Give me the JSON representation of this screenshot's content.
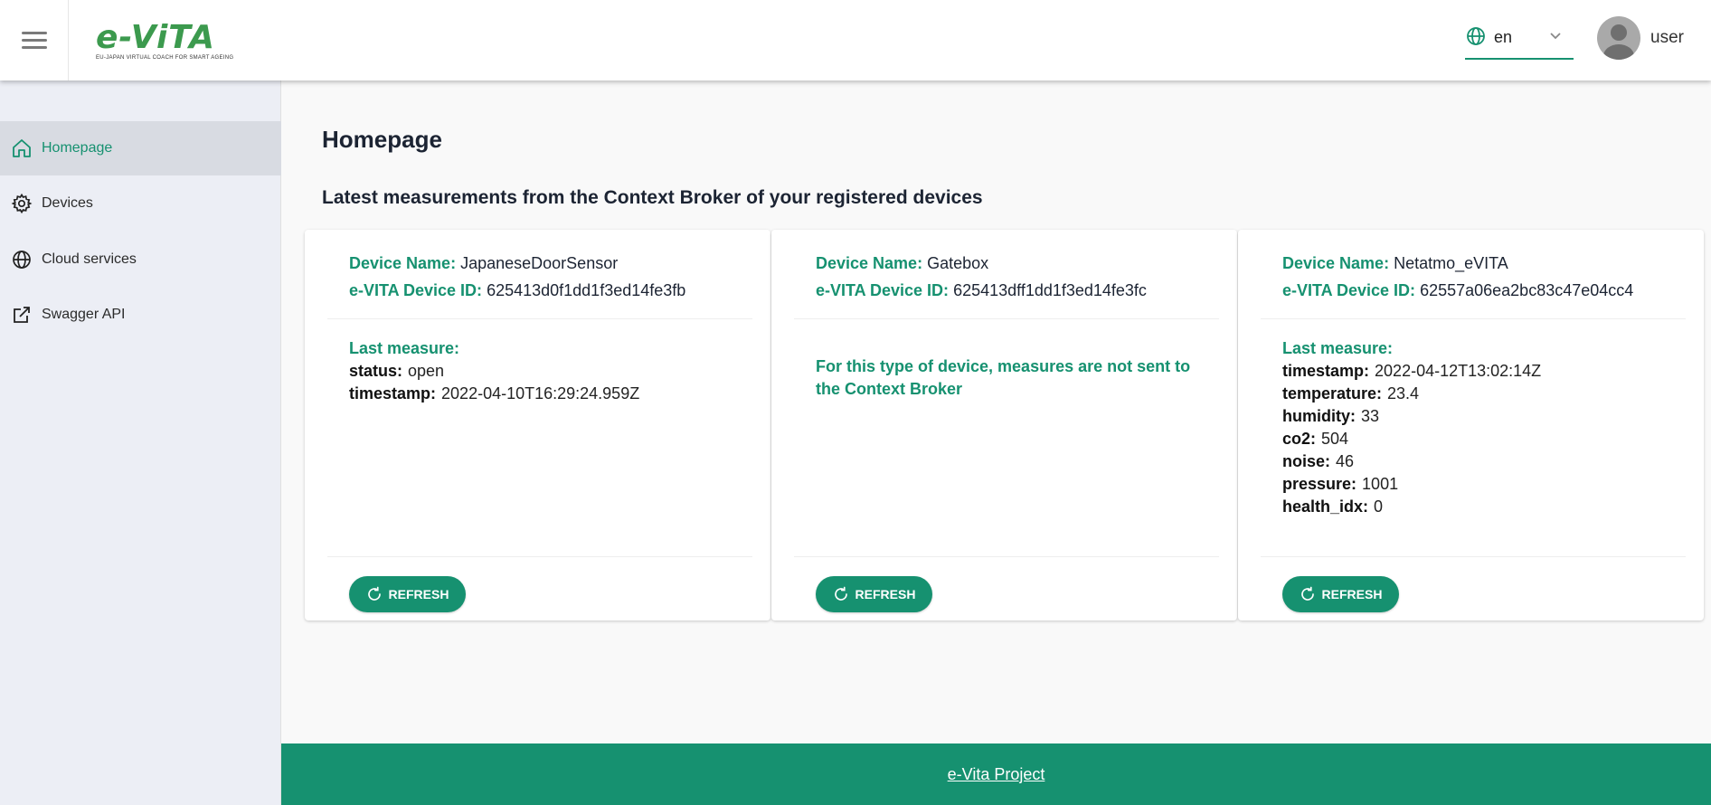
{
  "header": {
    "logo_text": "e-ViTA",
    "logo_subtitle": "EU-JAPAN VIRTUAL COACH FOR SMART AGEING",
    "language": "en",
    "username": "user"
  },
  "sidebar": {
    "items": [
      {
        "label": "Homepage",
        "icon": "home-icon",
        "active": true
      },
      {
        "label": "Devices",
        "icon": "gear-icon",
        "active": false
      },
      {
        "label": "Cloud services",
        "icon": "globe-icon",
        "active": false
      },
      {
        "label": "Swagger API",
        "icon": "external-link-icon",
        "active": false
      }
    ]
  },
  "main": {
    "title": "Homepage",
    "subtitle": "Latest measurements from the Context Broker of your registered devices",
    "labels": {
      "device_name": "Device Name:",
      "device_id": "e-VITA Device ID:",
      "last_measure": "Last measure:",
      "refresh": "REFRESH"
    },
    "cards": [
      {
        "device_name": "JapaneseDoorSensor",
        "device_id": "625413d0f1dd1f3ed14fe3fb",
        "measures": [
          {
            "key": "status:",
            "value": "open"
          },
          {
            "key": "timestamp:",
            "value": "2022-04-10T16:29:24.959Z"
          }
        ]
      },
      {
        "device_name": "Gatebox",
        "device_id": "625413dff1dd1f3ed14fe3fc",
        "note": "For this type of device, measures are not sent to the Context Broker"
      },
      {
        "device_name": "Netatmo_eVITA",
        "device_id": "62557a06ea2bc83c47e04cc4",
        "measures": [
          {
            "key": "timestamp:",
            "value": "2022-04-12T13:02:14Z"
          },
          {
            "key": "temperature:",
            "value": "23.4"
          },
          {
            "key": "humidity:",
            "value": "33"
          },
          {
            "key": "co2:",
            "value": "504"
          },
          {
            "key": "noise:",
            "value": "46"
          },
          {
            "key": "pressure:",
            "value": "1001"
          },
          {
            "key": "health_idx:",
            "value": "0"
          }
        ]
      }
    ]
  },
  "footer": {
    "link": "e-Vita Project"
  },
  "colors": {
    "accent": "#169170",
    "sidebar_bg": "#eceef5",
    "sidebar_active": "#d8dbe2"
  }
}
